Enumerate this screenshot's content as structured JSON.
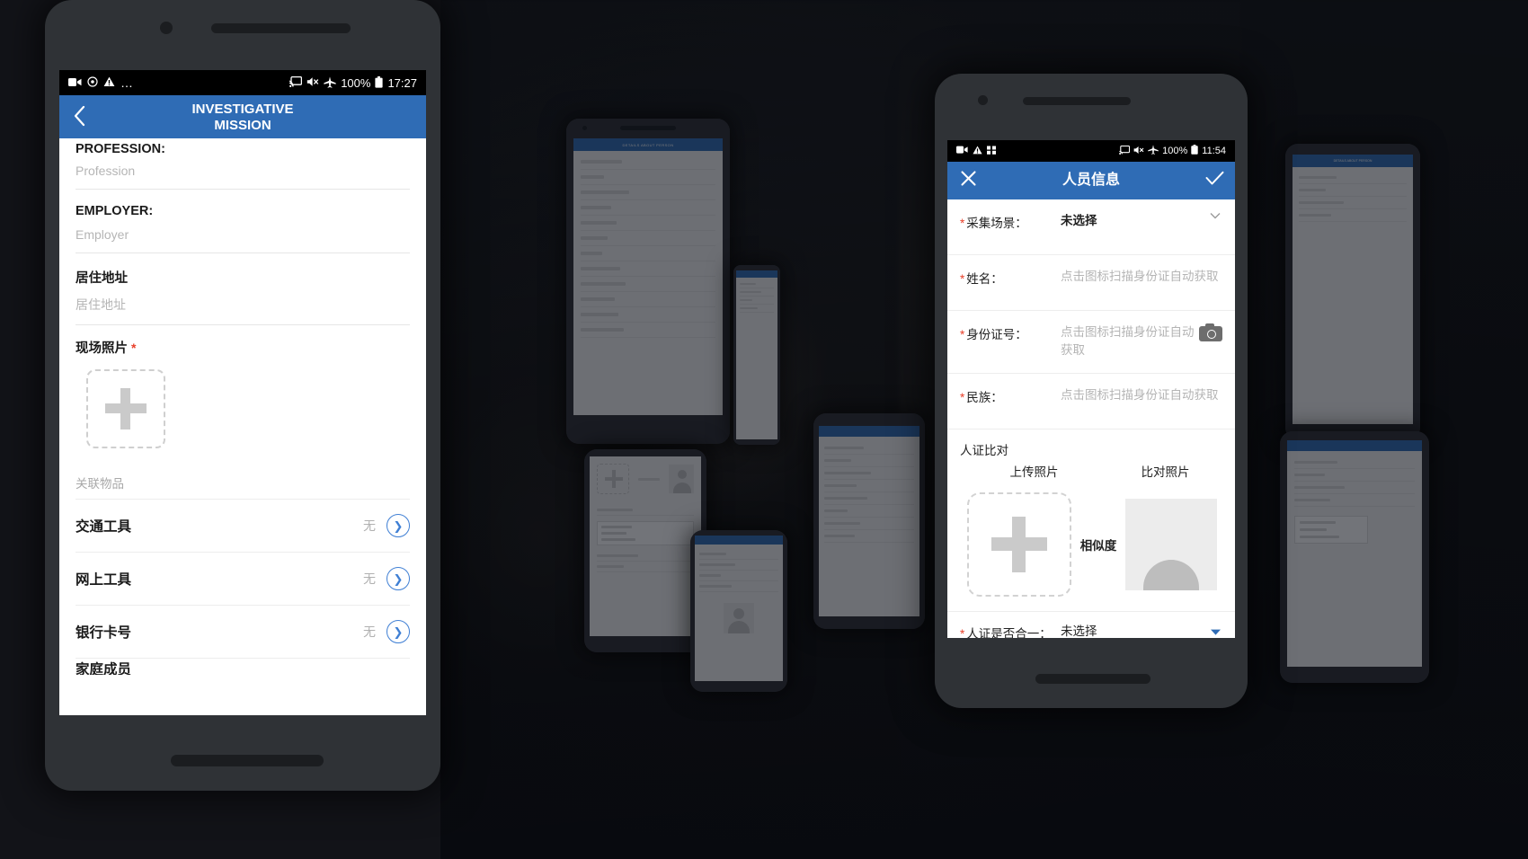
{
  "left_phone": {
    "statusbar": {
      "icons": [
        "video-camera-icon",
        "record-icon",
        "warning-icon",
        "more-icon"
      ],
      "right_icons": [
        "cast-icon",
        "mute-icon",
        "airplane-icon"
      ],
      "battery": "100%",
      "time": "17:27"
    },
    "appbar": {
      "back_icon": "chevron-left-icon",
      "title_line1": "INVESTIGATIVE",
      "title_line2": "MISSION"
    },
    "fields": [
      {
        "label": "PROFESSION:",
        "placeholder": "Profession",
        "clipped": true
      },
      {
        "label": "EMPLOYER:",
        "placeholder": "Employer",
        "clipped": false
      },
      {
        "label": "居住地址",
        "placeholder": "居住地址",
        "clipped": false
      }
    ],
    "photo_section": {
      "label": "现场照片",
      "required_mark": "*",
      "add_icon": "plus-icon"
    },
    "group_label": "关联物品",
    "rows": [
      {
        "label": "交通工具",
        "value": "无",
        "icon": "chevron-right-circle-icon"
      },
      {
        "label": "网上工具",
        "value": "无",
        "icon": "chevron-right-circle-icon"
      },
      {
        "label": "银行卡号",
        "value": "无",
        "icon": "chevron-right-circle-icon"
      }
    ],
    "partial_row": "家庭成员"
  },
  "right_phone": {
    "statusbar": {
      "icons": [
        "video-camera-icon",
        "warning-icon",
        "apps-icon"
      ],
      "right_icons": [
        "cast-icon",
        "mute-icon",
        "airplane-icon"
      ],
      "battery": "100%",
      "time": "11:54"
    },
    "appbar": {
      "close_icon": "close-icon",
      "title": "人员信息",
      "confirm_icon": "check-icon"
    },
    "fields": [
      {
        "label": "采集场景：",
        "value": "未选择",
        "filled": true,
        "caret": "chevron-down-icon",
        "camera": false
      },
      {
        "label": "姓名：",
        "value": "点击图标扫描身份证自动获取",
        "filled": false,
        "caret": "",
        "camera": false
      },
      {
        "label": "身份证号：",
        "value": "点击图标扫描身份证自动获取",
        "filled": false,
        "caret": "",
        "camera": true
      },
      {
        "label": "民族：",
        "value": "点击图标扫描身份证自动获取",
        "filled": false,
        "caret": "",
        "camera": false
      }
    ],
    "compare": {
      "title": "人证比对",
      "head_upload": "上传照片",
      "head_compare": "比对照片",
      "similarity_label": "相似度",
      "upload_icon": "plus-icon",
      "compare_icon": "person-avatar-icon"
    },
    "last_row": {
      "label": "人证是否合一：",
      "required_mark": "*",
      "value": "未选择",
      "caret": "chevron-down-icon"
    }
  },
  "background": {
    "mini_phones": [
      {
        "name": "mini-phone-details-about-person"
      },
      {
        "name": "mini-phone-list"
      },
      {
        "name": "mini-phone-photo-form"
      },
      {
        "name": "mini-phone-form-right"
      },
      {
        "name": "mini-phone-form-tall"
      },
      {
        "name": "mini-phone-edge-left"
      },
      {
        "name": "mini-phone-edge-right"
      }
    ]
  },
  "colors": {
    "accent_blue": "#2f6cb5",
    "required_red": "#e8402a",
    "muted_gray": "#b4b4b4"
  }
}
